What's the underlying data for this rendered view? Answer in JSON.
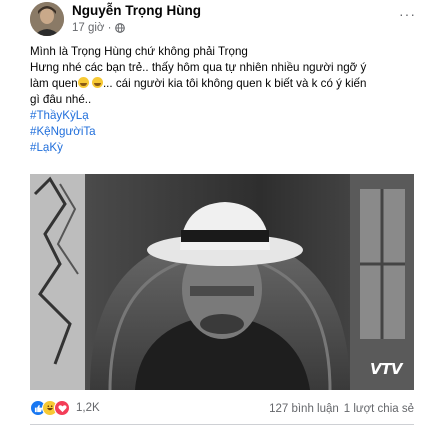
{
  "post": {
    "author": "Nguyễn Trọng Hùng",
    "time": "17 giờ ·",
    "privacy_icon": "globe-icon",
    "more_label": "···",
    "lines": [
      "Mình là Trọng Hùng chứ không phải Trọng",
      " Hưng nhé các bạn trẻ.. thấy  hôm qua tự nhiên nhiều người ngỡ ý",
      "gì đâu nhé.."
    ],
    "line3_prefix": "làm quen",
    "line3_suffix": "... cái người kia tôi không quen k biết và k có ý kiến",
    "hashtags": [
      "#ThầyKỳLạ",
      "#KệNgườiTa",
      "#LạKỳ"
    ],
    "watermark": "VTV",
    "reactions_count": "1,2K",
    "comments": "127 bình luận",
    "shares": "1 lượt chia sẻ"
  },
  "colors": {
    "link": "#216fdb",
    "secondary_text": "#65676b",
    "like": "#1877f2",
    "love": "#f33e58",
    "haha": "#f7c934"
  }
}
